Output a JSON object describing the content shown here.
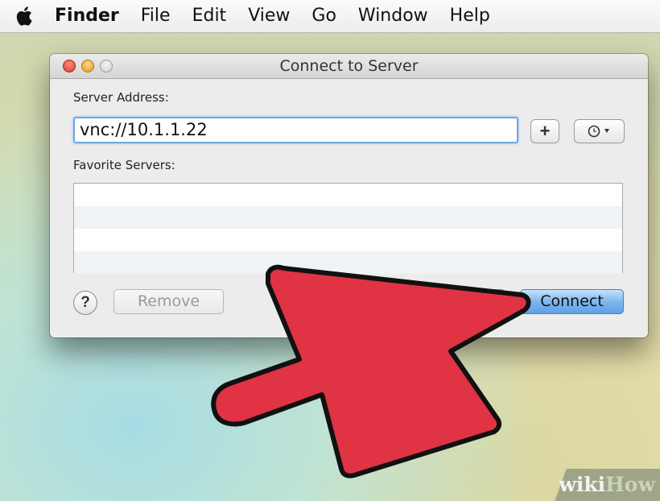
{
  "menubar": {
    "apple_icon": "apple-logo-icon",
    "items": [
      {
        "label": "Finder",
        "bold": true
      },
      {
        "label": "File"
      },
      {
        "label": "Edit"
      },
      {
        "label": "View"
      },
      {
        "label": "Go"
      },
      {
        "label": "Window"
      },
      {
        "label": "Help"
      }
    ]
  },
  "dialog": {
    "title": "Connect to Server",
    "server_address_label": "Server Address:",
    "server_address_value": "vnc://10.1.1.22",
    "add_button_label": "+",
    "recent_icon": "clock-icon",
    "favorites_label": "Favorite Servers:",
    "favorites": [],
    "help_label": "?",
    "remove_label": "Remove",
    "browse_label": "",
    "connect_label": "Connect"
  },
  "overlay": {
    "arrow_color": "#e03344",
    "arrow_outline": "#111111"
  },
  "watermark": {
    "part1": "wiki",
    "part2": "How"
  },
  "colors": {
    "focus_ring": "#6fa6e0",
    "default_button": "#7fb6ee"
  }
}
